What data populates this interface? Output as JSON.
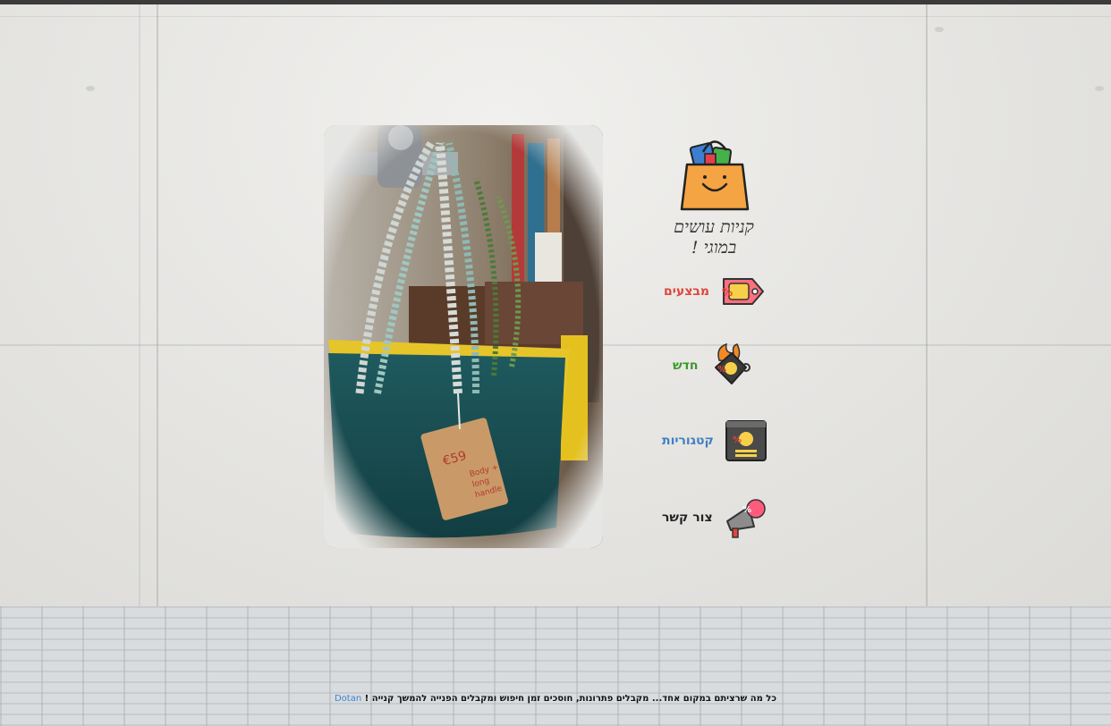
{
  "brand": {
    "tagline": "קניות עושים במוגי !"
  },
  "menu": [
    {
      "label": "מבצעים",
      "icon": "sale-tag-icon",
      "color": "#e0463b"
    },
    {
      "label": "חדש",
      "icon": "hot-tag-icon",
      "color": "#3a9a2a"
    },
    {
      "label": "קטגוריות",
      "icon": "catalog-icon",
      "color": "#3f7fc1"
    },
    {
      "label": "צור קשר",
      "icon": "megaphone-icon",
      "color": "#222222"
    }
  ],
  "footer": {
    "text": "כל מה שרציתם במקום אחד... מקבלים פתרונות, חוסכים זמן חיפוש ומקבלים הפנייה להמשך קנייה !",
    "link_label": "Dotan",
    "link_color": "#3c82d8"
  },
  "colors": {
    "bag_orange": "#f5a443",
    "background": "#e6e6e4"
  }
}
